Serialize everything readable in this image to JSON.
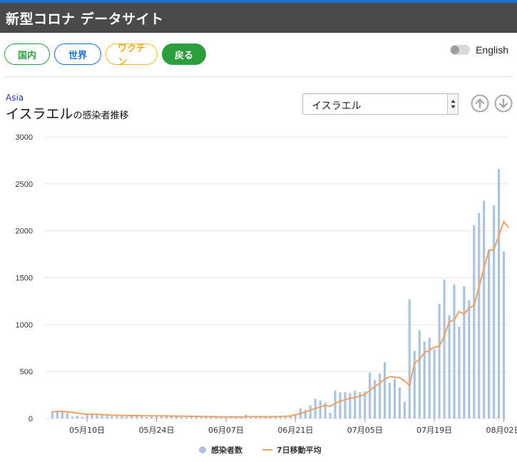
{
  "header": {
    "title": "新型コロナ データサイト"
  },
  "nav": {
    "domestic": "国内",
    "world": "世界",
    "vaccine": "ワクチン",
    "back": "戻る"
  },
  "language": {
    "label": "English"
  },
  "region": "Asia",
  "country": {
    "name": "イスラエル",
    "subtitle": "の感染者推移"
  },
  "select": {
    "value": "イスラエル"
  },
  "colors": {
    "bars": "#adc3dd",
    "line": "#f0a060",
    "header": "#4a4a4a",
    "accent": "#1e6fd6"
  },
  "chart_data": {
    "type": "bar",
    "ylim": [
      0,
      3000
    ],
    "yticks": [
      0,
      500,
      1000,
      1500,
      2000,
      2500,
      3000
    ],
    "xticks": [
      {
        "index": 7,
        "label": "05月10日"
      },
      {
        "index": 21,
        "label": "05月24日"
      },
      {
        "index": 35,
        "label": "06月07日"
      },
      {
        "index": 49,
        "label": "06月21日"
      },
      {
        "index": 63,
        "label": "07月05日"
      },
      {
        "index": 77,
        "label": "07月19日"
      },
      {
        "index": 91,
        "label": "08月02日"
      }
    ],
    "series": [
      {
        "name": "感染者数",
        "type": "bar",
        "values": [
          80,
          70,
          75,
          60,
          20,
          30,
          20,
          55,
          50,
          40,
          35,
          30,
          25,
          30,
          35,
          20,
          40,
          40,
          35,
          15,
          20,
          30,
          30,
          20,
          20,
          25,
          15,
          20,
          20,
          15,
          20,
          20,
          20,
          15,
          15,
          20,
          20,
          15,
          15,
          40,
          20,
          20,
          15,
          15,
          20,
          20,
          20,
          20,
          30,
          50,
          110,
          90,
          140,
          210,
          190,
          170,
          60,
          300,
          280,
          280,
          270,
          295,
          280,
          290,
          490,
          410,
          480,
          600,
          380,
          420,
          330,
          180,
          1270,
          720,
          940,
          820,
          860,
          740,
          1220,
          1480,
          1100,
          1430,
          980,
          1410,
          1260,
          2060,
          2190,
          2320,
          1800,
          2270,
          2660,
          1780
        ],
        "color": "#adc3dd"
      },
      {
        "name": "7日移動平均",
        "type": "line",
        "values": [
          70,
          75,
          75,
          73,
          65,
          58,
          52,
          45,
          45,
          45,
          42,
          38,
          35,
          35,
          33,
          31,
          30,
          31,
          30,
          28,
          28,
          29,
          28,
          27,
          26,
          25,
          24,
          24,
          23,
          22,
          21,
          21,
          20,
          19,
          18,
          18,
          18,
          18,
          17,
          20,
          20,
          20,
          20,
          19,
          19,
          20,
          22,
          23,
          27,
          40,
          55,
          70,
          90,
          105,
          125,
          140,
          130,
          160,
          185,
          200,
          215,
          225,
          240,
          255,
          300,
          340,
          375,
          420,
          445,
          440,
          435,
          400,
          350,
          590,
          630,
          700,
          730,
          760,
          770,
          880,
          1030,
          1050,
          1140,
          1110,
          1180,
          1200,
          1400,
          1600,
          1790,
          1800,
          1950,
          2100,
          2030
        ],
        "color": "#f0a060"
      }
    ],
    "legend": {
      "position": "bottom",
      "items": [
        "感染者数",
        "7日移動平均"
      ]
    },
    "grid": true
  }
}
